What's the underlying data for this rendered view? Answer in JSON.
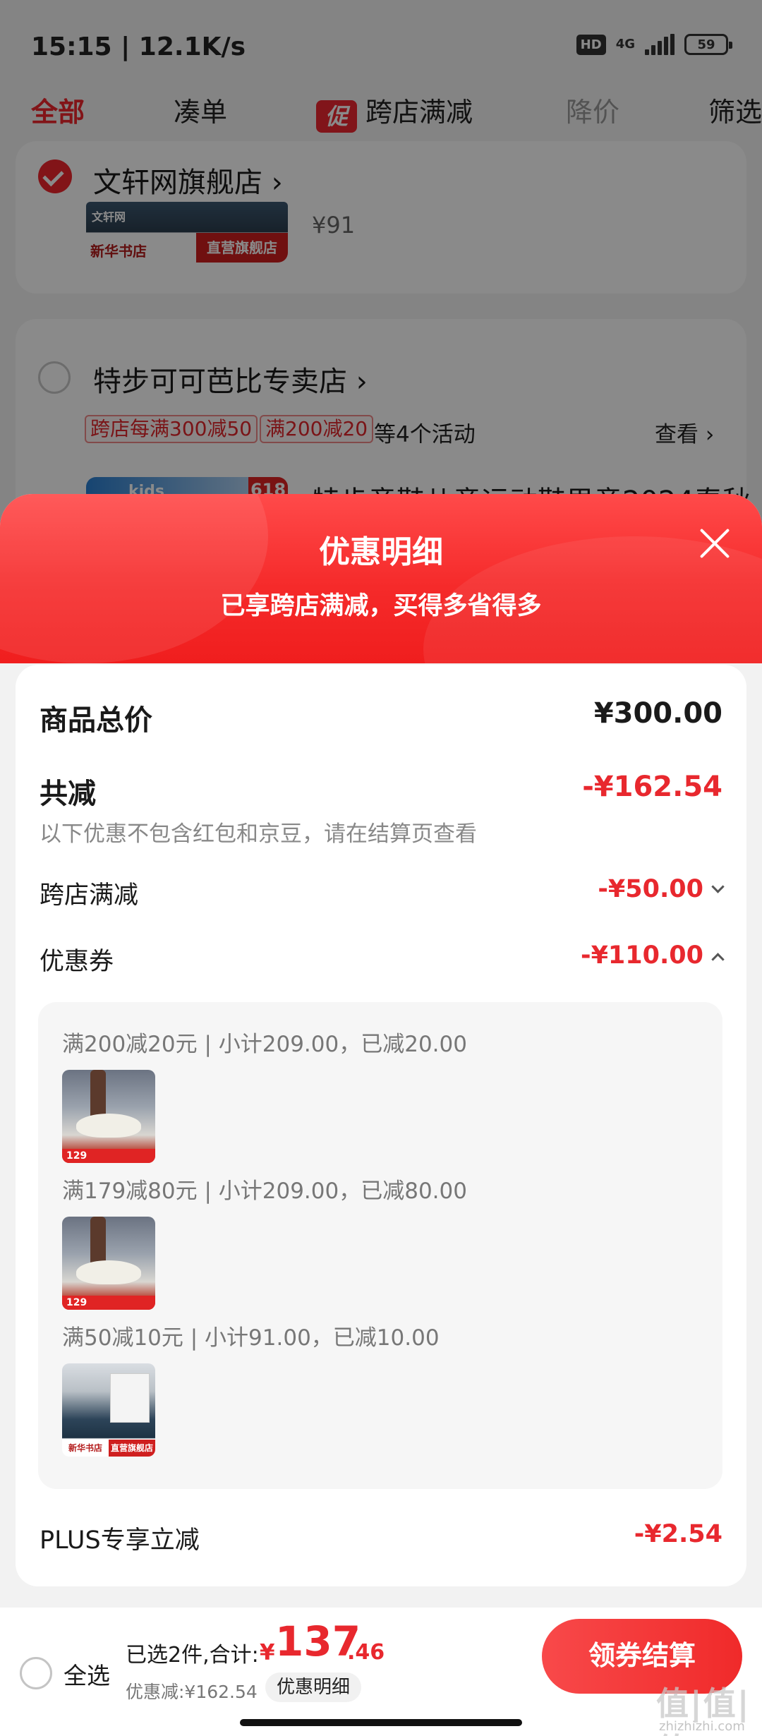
{
  "status_bar": {
    "time_speed": "15:15 | 12.1K/s",
    "hd": "HD",
    "network": "4G",
    "battery": "59"
  },
  "tabs": [
    {
      "label": "全部",
      "active": true
    },
    {
      "label": "凑单"
    },
    {
      "label": "跨店满减",
      "badge": "促"
    },
    {
      "label": "降价",
      "muted": true
    },
    {
      "label": "筛选"
    }
  ],
  "stores": [
    {
      "name": "文轩网旗舰店",
      "selected": true,
      "price": "¥91",
      "thumb_left": "新华书店",
      "thumb_right": "直营旗舰店",
      "thumb_top": "文轩网"
    },
    {
      "name": "特步可可芭比专卖店",
      "selected": false,
      "promo_tags": [
        "跨店每满300减50",
        "满200减20"
      ],
      "promo_more": "等4个活动",
      "view_link": "查看",
      "product_title_partial": "特步童鞋儿童运动鞋男童2024春秋",
      "thumb_badge": "618",
      "thumb_brand": "kids"
    }
  ],
  "sheet": {
    "title": "优惠明细",
    "subtitle": "已享跨店满减，买得多省得多",
    "total_label": "商品总价",
    "total_value": "¥300.00",
    "reduce_label": "共减",
    "reduce_value": "-¥162.54",
    "note": "以下优惠不包含红包和京豆，请在结算页查看",
    "cross_store_label": "跨店满减",
    "cross_store_value": "-¥50.00",
    "coupon_label": "优惠券",
    "coupon_value": "-¥110.00",
    "coupons": [
      {
        "line": "满200减20元 | 小计209.00，已减20.00",
        "thumb": "shoe",
        "price_tag": "129"
      },
      {
        "line": "满179减80元 | 小计209.00，已减80.00",
        "thumb": "shoe",
        "price_tag": "129"
      },
      {
        "line": "满50减10元 | 小计91.00，已减10.00",
        "thumb": "book",
        "thumb_left": "新华书店",
        "thumb_right": "直营旗舰店"
      }
    ],
    "plus_label": "PLUS专享立减",
    "plus_value": "-¥2.54"
  },
  "bottom_bar": {
    "select_all": "全选",
    "summary": "已选2件,合计:",
    "currency": "¥",
    "total_int": "137",
    "total_dec": ".46",
    "discount": "优惠减:¥162.54",
    "detail_pill": "优惠明细",
    "checkout": "领券结算",
    "watermark": "值|值|值",
    "watermark_url": "zhizhizhi.com"
  },
  "colors": {
    "accent_red": "#e8282e",
    "header_red": "#f52a2a",
    "overlay": "rgba(0,0,0,0.46)"
  }
}
